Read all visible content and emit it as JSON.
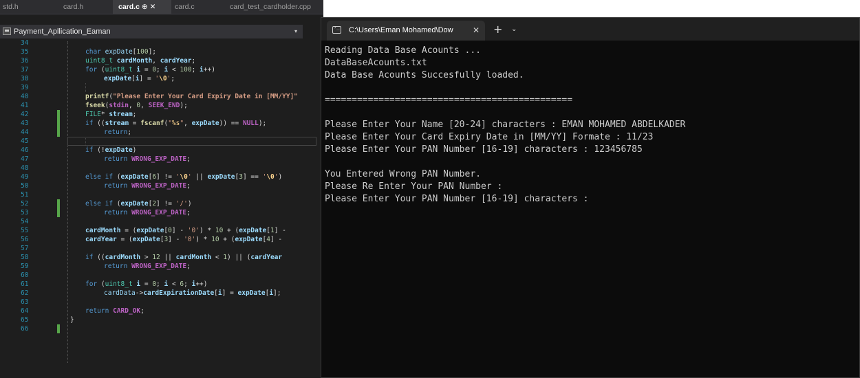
{
  "ide": {
    "tabs": [
      {
        "label": "std.h",
        "active": false
      },
      {
        "label": "card.h",
        "active": false
      },
      {
        "label": "card.c",
        "active": true,
        "pin": "⊕",
        "close": "✕"
      },
      {
        "label": "card.c",
        "active": false
      },
      {
        "label": "card_test_cardholder.cpp",
        "active": false
      }
    ],
    "project": "Payment_Apllication_Eaman",
    "dropdown_glyph": "▾",
    "line_numbers": [
      "34",
      "35",
      "36",
      "37",
      "38",
      "39",
      "40",
      "41",
      "42",
      "43",
      "44",
      "45",
      "46",
      "47",
      "48",
      "49",
      "50",
      "51",
      "52",
      "53",
      "54",
      "55",
      "56",
      "57",
      "58",
      "59",
      "60",
      "61",
      "62",
      "63",
      "64",
      "65",
      "66"
    ],
    "closing_brace": "}",
    "current_line": "44",
    "change_bars": [
      "42-44",
      "50-51",
      "66"
    ]
  },
  "terminal": {
    "tab_title": "C:\\Users\\Eman Mohamed\\Dow",
    "close_glyph": "✕",
    "new_tab_glyph": "+",
    "dropdown_glyph": "⌄",
    "lines": [
      "Reading Data Base Acounts ...",
      "DataBaseAcounts.txt",
      "Data Base Acounts Succesfully loaded.",
      "",
      "==============================================",
      "",
      "Please Enter Your Name [20-24] characters : EMAN MOHAMED ABDELKADER",
      "Please Enter Your Card Expiry Date in [MM/YY] Formate : 11/23",
      "Please Enter Your PAN Number [16-19] characters : 123456785",
      "",
      "You Entered Wrong PAN Number.",
      "Please Re Enter Your PAN Number :",
      "Please Enter Your PAN Number [16-19] characters :"
    ]
  },
  "colors": {
    "ide_bg": "#1e1e1e",
    "terminal_bg": "#0c0c0c",
    "keyword": "#569cd6",
    "type": "#4ec9b0",
    "string": "#d69d85",
    "macro": "#bd63c5",
    "line_number": "#2b91af",
    "change_bar": "#57a64a"
  }
}
